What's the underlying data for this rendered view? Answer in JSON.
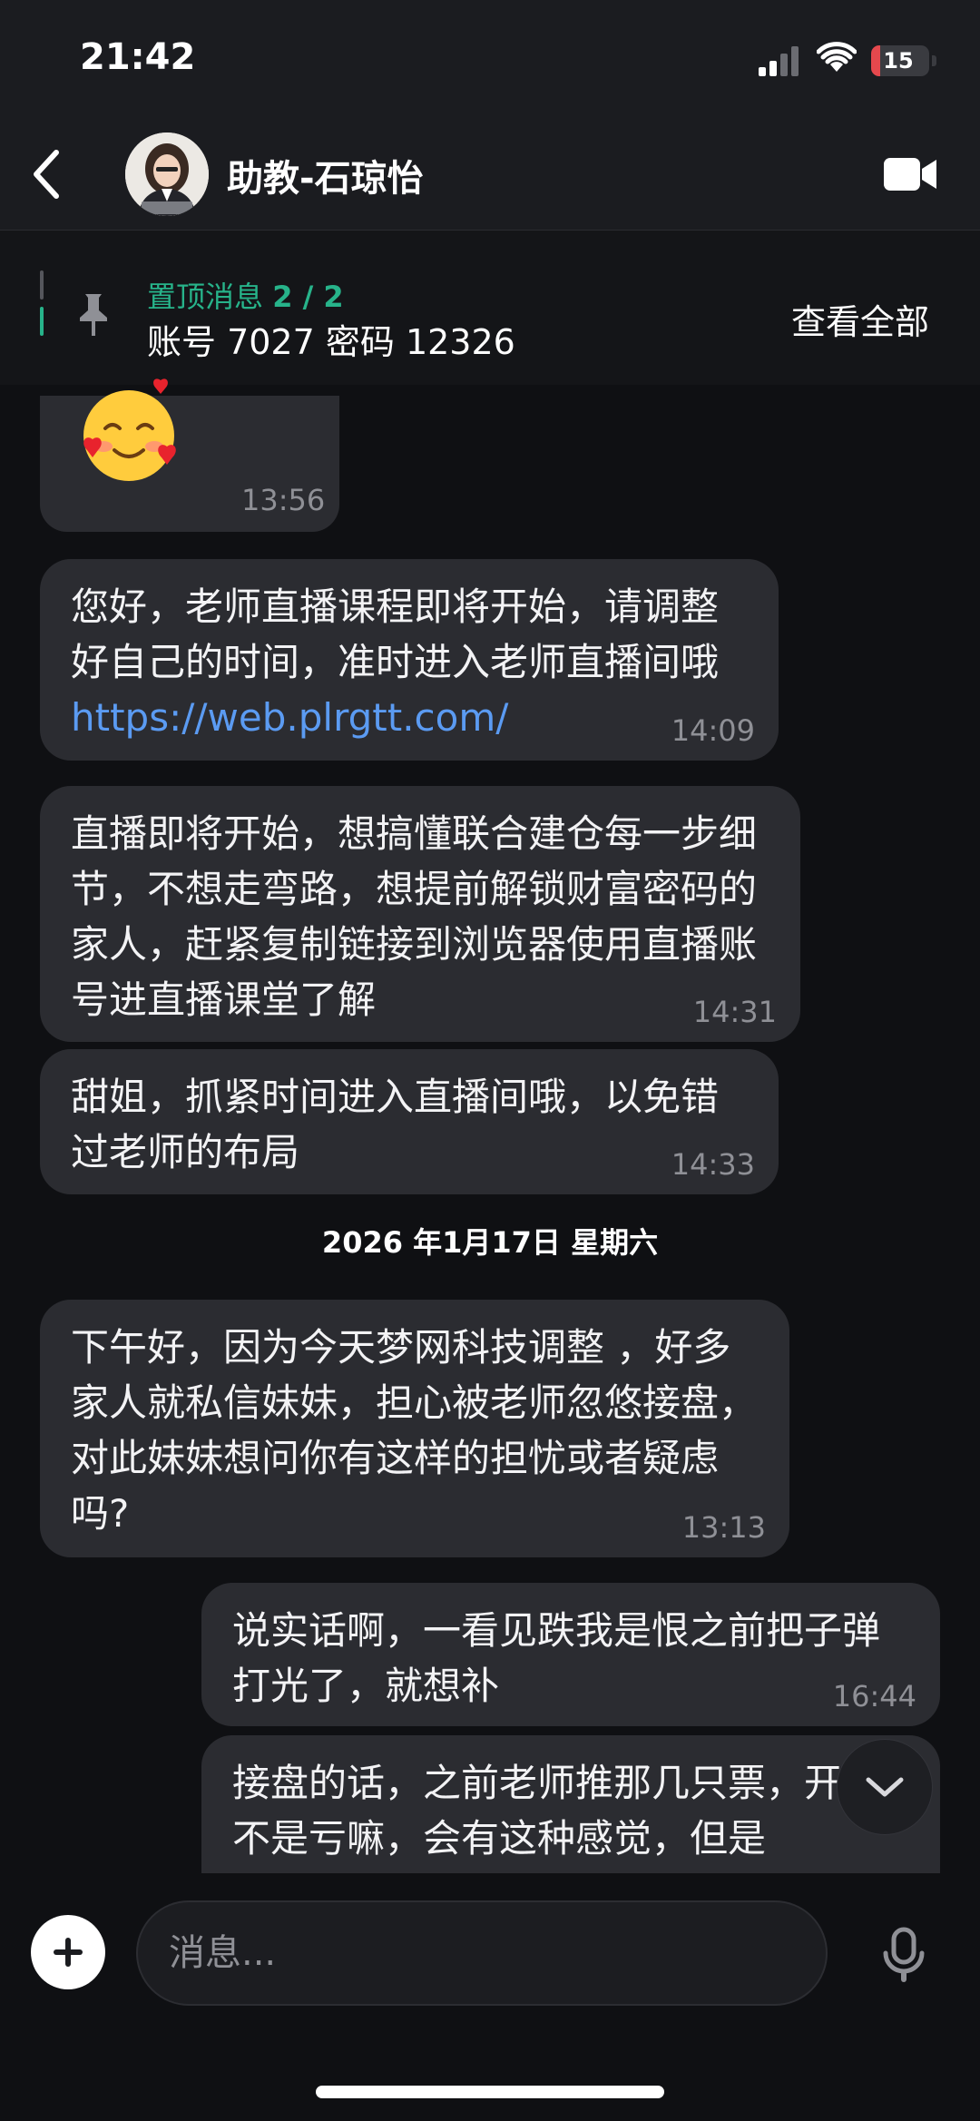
{
  "status_bar": {
    "time": "21:42",
    "battery_level": "15",
    "battery_fraction": 0.15,
    "signal_icon": "cellular-signal-icon",
    "wifi_icon": "wifi-icon"
  },
  "header": {
    "name": "助教-石琼怡",
    "back_icon": "chevron-left-icon",
    "video_icon": "video-camera-icon"
  },
  "pinned": {
    "label": "置顶消息",
    "counter": "2 / 2",
    "text": "账号 7027 密码 12326",
    "view_all": "查看全部",
    "icon": "pin-icon"
  },
  "messages": [
    {
      "direction": "in",
      "kind": "emoji",
      "emoji": "smiling-face-with-hearts",
      "time": "13:56"
    },
    {
      "direction": "in",
      "text": "您好，老师直播课程即将开始，请调整好自己的时间，准时进入老师直播间哦 ",
      "link": "https://web.plrgtt.com/",
      "time": "14:09"
    },
    {
      "direction": "in",
      "text": "直播即将开始，想搞懂联合建仓每一步细节，不想走弯路，想提前解锁财富密码的家人，赶紧复制链接到浏览器使用直播账号进直播课堂了解",
      "time": "14:31"
    },
    {
      "direction": "in",
      "text": "甜姐，抓紧时间进入直播间哦，以免错过老师的布局",
      "time": "14:33"
    },
    {
      "direction": "divider",
      "text": "2026 年1月17日 星期六"
    },
    {
      "direction": "in",
      "text": "下午好，因为今天梦网科技调整 ，好多家人就私信妹妹，担心被老师忽悠接盘，对此妹妹想问你有这样的担忧或者疑虑吗?",
      "time": "13:13"
    },
    {
      "direction": "out",
      "text": "说实话啊，一看见跌我是恨之前把子弹打光了，就想补",
      "time": "16:44"
    },
    {
      "direction": "out",
      "text": "接盘的话，之前老师推那几只票，开始不是亏嘛，会有这种感觉，但是"
    }
  ],
  "composer": {
    "placeholder": "消息...",
    "add_icon": "plus-icon",
    "mic_icon": "microphone-icon",
    "scroll_icon": "chevron-down-icon"
  },
  "colors": {
    "background": "#0f1013",
    "bar": "#1b1c20",
    "bubble": "#2b2c31",
    "accent_green": "#27b38a",
    "link_blue": "#5b9bf2",
    "battery_red": "#e5484d"
  }
}
